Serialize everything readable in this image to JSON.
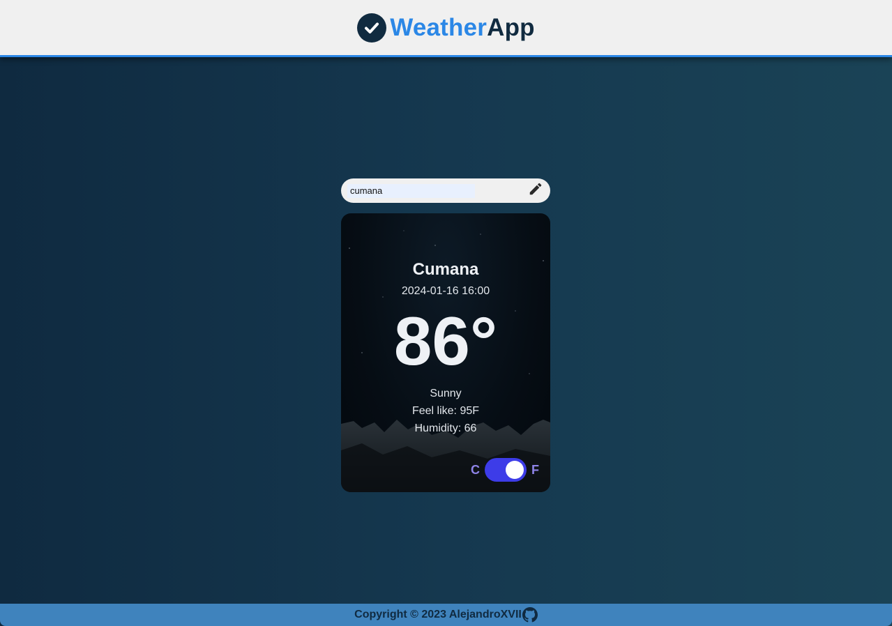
{
  "header": {
    "brand_part1": "Weather",
    "brand_part2": "App",
    "brand_icon": "check-circle-icon",
    "accent_color": "#2b87e6",
    "dark_color": "#112b40"
  },
  "search": {
    "value": "cumana",
    "edit_icon": "pencil-icon"
  },
  "weather": {
    "city": "Cumana",
    "datetime": "2024-01-16 16:00",
    "temperature": "86°",
    "condition": "Sunny",
    "feels_like": "Feel like: 95F",
    "humidity": "Humidity: 66"
  },
  "units": {
    "celsius_label": "C",
    "fahrenheit_label": "F",
    "selected": "F",
    "toggle_color": "#3d3ce8"
  },
  "footer": {
    "copyright": "Copyright © 2023 AlejandroXVII",
    "link_icon": "github-icon",
    "bg_color": "#3f83bd"
  }
}
